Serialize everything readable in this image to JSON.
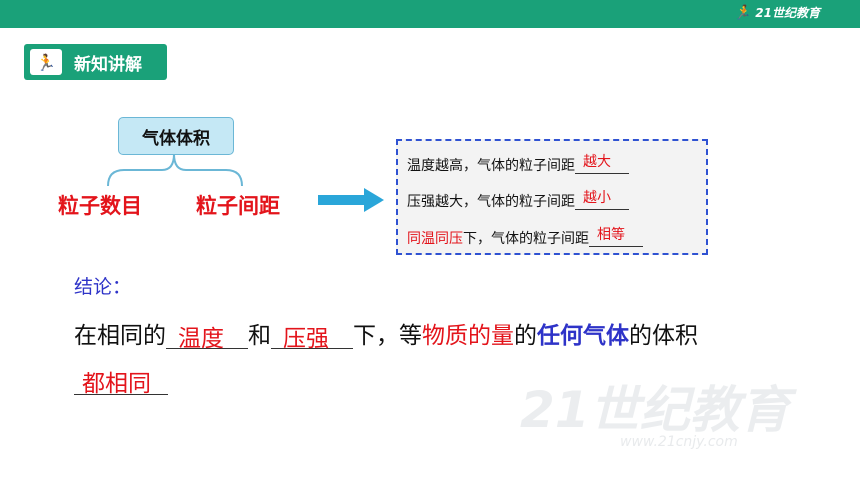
{
  "brand": {
    "text": "21世纪教育",
    "runner": "🏃"
  },
  "section": {
    "icon": "🏃",
    "title": "新知讲解"
  },
  "concept": {
    "title": "气体体积",
    "factor1": "粒子数目",
    "factor2": "粒子间距"
  },
  "box_rows": [
    {
      "highlight": "",
      "text": "温度越高，气体的粒子间距",
      "answer": "越大"
    },
    {
      "highlight": "",
      "text": "压强越大，气体的粒子间距",
      "answer": "越小"
    },
    {
      "highlight": "同温同压",
      "text": "下，气体的粒子间距",
      "answer": "相等"
    }
  ],
  "conclusion": {
    "label": "结论：",
    "part1": "在相同的",
    "blank1": "温度",
    "part2": "和",
    "blank2": "压强",
    "part3": "下，等",
    "red": "物质的量",
    "part4": "的",
    "blue": "任何气体",
    "part5": "的体积",
    "blank3": "都相同"
  },
  "watermark": {
    "text": "21世纪教育",
    "url": "www.21cnjy.com"
  },
  "colors": {
    "green": "#1aa179",
    "red": "#e3141b",
    "blue": "#2e33c8",
    "dash": "#2f52d2"
  }
}
